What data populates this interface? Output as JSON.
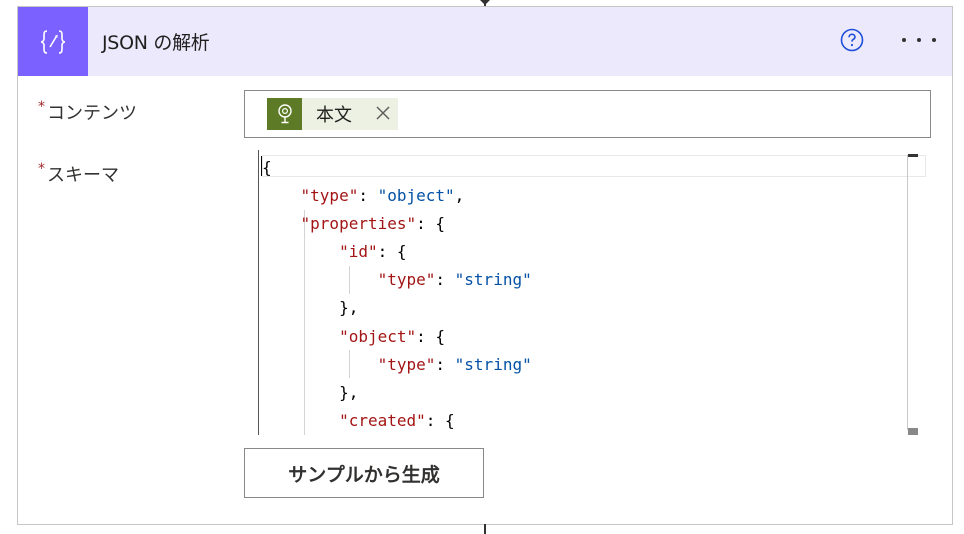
{
  "action": {
    "title": "JSON の解析",
    "icon": "curly-braces-icon",
    "accent_color": "#7b61ff",
    "header_bg": "#ede9fd"
  },
  "fields": {
    "content": {
      "required_mark": "*",
      "label": "コンテンツ",
      "token": {
        "label": "本文",
        "icon": "dynamic-content-icon",
        "color": "#5d7b26"
      }
    },
    "schema": {
      "required_mark": "*",
      "label": "スキーマ",
      "lines": [
        "{",
        "    \"type\": \"object\",",
        "    \"properties\": {",
        "        \"id\": {",
        "            \"type\": \"string\"",
        "        },",
        "        \"object\": {",
        "            \"type\": \"string\"",
        "        },",
        "        \"created\": {"
      ]
    }
  },
  "buttons": {
    "generate_from_sample": "サンプルから生成"
  }
}
